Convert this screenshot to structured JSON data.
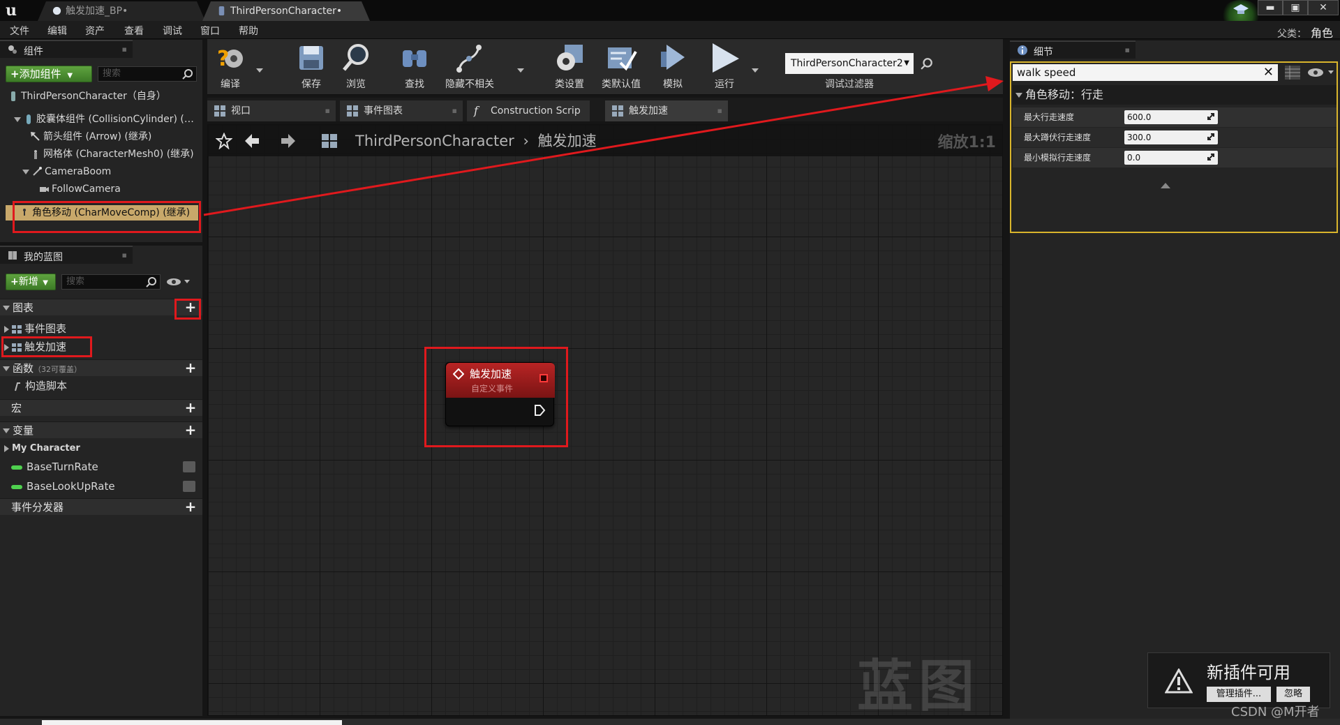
{
  "title_bar": {
    "tabs": [
      {
        "label": "触发加速_BP•"
      },
      {
        "label": "ThirdPersonCharacter•"
      }
    ],
    "win_min": "▬",
    "win_max": "▣",
    "win_close": "✕"
  },
  "menu": {
    "items": [
      "文件",
      "编辑",
      "资产",
      "查看",
      "调试",
      "窗口",
      "帮助"
    ],
    "parent_label": "父类：",
    "parent_value": "角色"
  },
  "components": {
    "tab_label": "组件",
    "add_button": "添加组件",
    "search_placeholder": "搜索",
    "root": "ThirdPersonCharacter（自身）",
    "items": [
      "胶囊体组件 (CollisionCylinder) (继承)",
      "箭头组件 (Arrow) (继承)",
      "网格体 (CharacterMesh0) (继承)",
      "CameraBoom",
      "FollowCamera",
      "角色移动 (CharMoveComp) (继承)"
    ]
  },
  "my_blueprint": {
    "tab_label": "我的蓝图",
    "new_button": "新增",
    "search_placeholder": "搜索",
    "graphs_header": "图表",
    "graphs": [
      "事件图表",
      "触发加速"
    ],
    "functions_header": "函数",
    "functions_override": "（32可覆盖）",
    "functions": [
      "构造脚本"
    ],
    "macros_header": "宏",
    "variables_header": "变量",
    "variable_category": "My Character",
    "variables": [
      "BaseTurnRate",
      "BaseLookUpRate"
    ],
    "dispatchers_header": "事件分发器"
  },
  "toolbar": {
    "compile": "编译",
    "save": "保存",
    "browse": "浏览",
    "find": "查找",
    "hide_unrelated": "隐藏不相关",
    "class_settings": "类设置",
    "class_defaults": "类默认值",
    "simulate": "模拟",
    "play": "运行",
    "debug_object": "ThirdPersonCharacter2",
    "debug_filter": "调试过滤器"
  },
  "graph_tabs": [
    "视口",
    "事件图表",
    "Construction Scrip",
    "触发加速"
  ],
  "graph": {
    "crumb_root": "ThirdPersonCharacter",
    "crumb_current": "触发加速",
    "zoom": "缩放1:1",
    "watermark": "蓝图",
    "node_title": "触发加速",
    "node_subtitle": "自定义事件"
  },
  "details": {
    "tab_label": "细节",
    "search_value": "walk speed",
    "category": "角色移动：行走",
    "rows": [
      {
        "label": "最大行走速度",
        "value": "600.0"
      },
      {
        "label": "最大蹲伏行走速度",
        "value": "300.0"
      },
      {
        "label": "最小模拟行走速度",
        "value": "0.0"
      }
    ]
  },
  "notification": {
    "title": "新插件可用",
    "manage": "管理插件...",
    "ignore": "忽略"
  },
  "watermark_csdn": "CSDN @M开者",
  "colors": {
    "highlight_red": "#e0191d",
    "details_outline": "#d9b52c",
    "node_header": "#a01a1a"
  }
}
